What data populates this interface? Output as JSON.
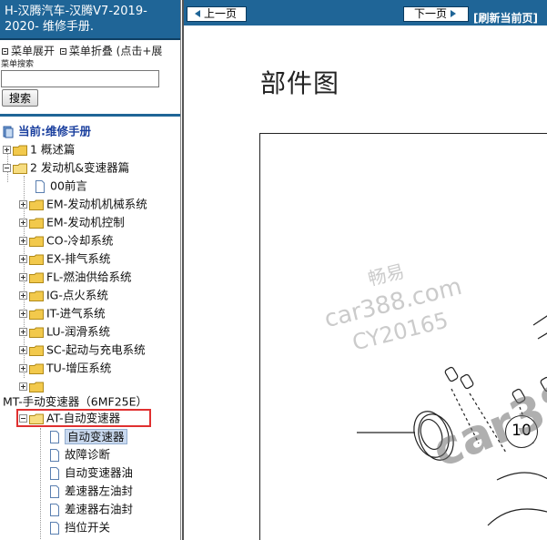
{
  "sidebar": {
    "title": "H-汉腾汽车-汉腾V7-2019-2020- 维修手册.",
    "menu_expand": "菜单展开",
    "menu_collapse": "菜单折叠 (点击+展",
    "search_label": "菜单搜索",
    "search_value": "",
    "search_button": "搜索",
    "current_label": "当前:维修手册",
    "tree": [
      {
        "label": "1 概述篇",
        "expanded": false
      },
      {
        "label": "2 发动机&变速器篇",
        "expanded": true
      },
      {
        "label": "00前言"
      },
      {
        "label": "EM-发动机机械系统"
      },
      {
        "label": "EM-发动机控制"
      },
      {
        "label": "CO-冷却系统"
      },
      {
        "label": "EX-排气系统"
      },
      {
        "label": "FL-燃油供给系统"
      },
      {
        "label": "IG-点火系统"
      },
      {
        "label": "IT-进气系统"
      },
      {
        "label": "LU-润滑系统"
      },
      {
        "label": "SC-起动与充电系统"
      },
      {
        "label": "TU-增压系统"
      },
      {
        "label": ""
      },
      {
        "label": "MT-手动变速器（6MF25E）"
      },
      {
        "label": "AT-自动变速器",
        "expanded": true
      },
      {
        "label": "自动变速器",
        "selected": true
      },
      {
        "label": "故障诊断"
      },
      {
        "label": "自动变速器油"
      },
      {
        "label": "差速器左油封"
      },
      {
        "label": "差速器右油封"
      },
      {
        "label": "挡位开关"
      }
    ]
  },
  "content": {
    "prev_label": "上一页",
    "next_label": "下一页",
    "refresh_label": "[刷新当前页]",
    "page_title": "部件图",
    "watermark_name": "畅易",
    "watermark_site": "car388.com",
    "watermark_code": "CY20165",
    "big_watermark": "car388.c",
    "callout_number": "10"
  },
  "colors": {
    "header_blue": "#1f6597",
    "highlight_red": "#e03030",
    "folder_yellow": "#f2c94c"
  }
}
